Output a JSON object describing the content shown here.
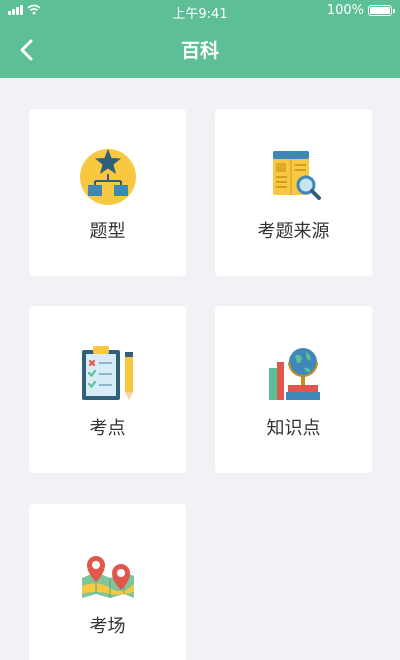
{
  "status_bar": {
    "time": "上午9:41",
    "battery": "100%",
    "icons": [
      "signal-icon",
      "wifi-icon",
      "battery-icon"
    ]
  },
  "nav": {
    "title": "百科",
    "back_icon": "chevron-left-icon"
  },
  "colors": {
    "header": "#5dbf95",
    "background": "#f1f2f6",
    "card": "#ffffff"
  },
  "cards": [
    {
      "label": "题型",
      "icon": "hierarchy-star-icon"
    },
    {
      "label": "考题来源",
      "icon": "document-search-icon"
    },
    {
      "label": "考点",
      "icon": "checklist-pencil-icon"
    },
    {
      "label": "知识点",
      "icon": "books-globe-icon"
    },
    {
      "label": "考场",
      "icon": "map-pins-icon"
    }
  ]
}
